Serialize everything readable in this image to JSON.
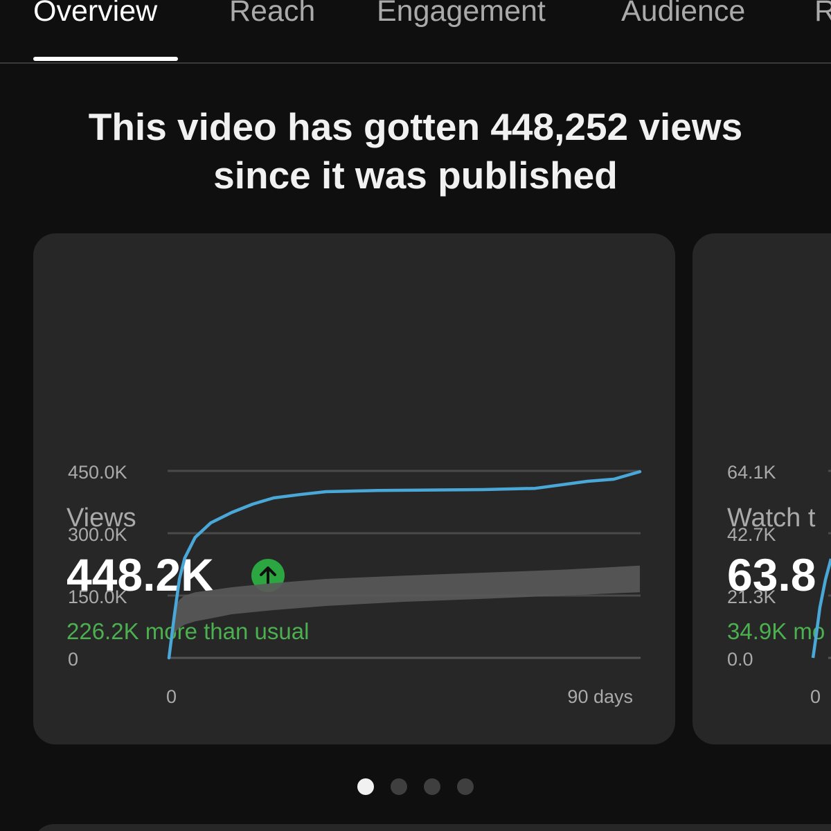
{
  "tabs": [
    {
      "label": "Overview",
      "active": true
    },
    {
      "label": "Reach",
      "active": false
    },
    {
      "label": "Engagement",
      "active": false
    },
    {
      "label": "Audience",
      "active": false
    },
    {
      "label": "R",
      "active": false
    }
  ],
  "headline": {
    "line1": "This video has gotten 448,252 views",
    "line2": "since it was published"
  },
  "cards": [
    {
      "label": "Views",
      "value": "448.2K",
      "trend_icon": "arrow-up-icon",
      "comparison": "226.2K more than usual"
    },
    {
      "label": "Watch t",
      "value": "63.8",
      "comparison": "34.9K mo"
    }
  ],
  "colors": {
    "background": "#0f0f0f",
    "card": "#272727",
    "series_line": "#4aa8d8",
    "typical_range": "#5a5a5a",
    "positive": "#4caf50",
    "badge": "#2ba640"
  },
  "chart_data": [
    {
      "type": "area",
      "x_tick_labels": [
        "0",
        "90 days"
      ],
      "y_tick_labels": [
        "0",
        "150.0K",
        "300.0K",
        "450.0K"
      ],
      "xlim": [
        0,
        90
      ],
      "ylim": [
        0,
        450000
      ],
      "series": [
        {
          "x": [
            0,
            1,
            2,
            3,
            5,
            8,
            12,
            16,
            20,
            25,
            30,
            40,
            50,
            60,
            70,
            80,
            85,
            90
          ],
          "values": [
            0,
            100000,
            190000,
            240000,
            290000,
            325000,
            350000,
            370000,
            385000,
            393000,
            400000,
            403000,
            404000,
            405000,
            408000,
            425000,
            430000,
            448200
          ]
        },
        {
          "type": "range",
          "x": [
            0,
            1,
            2,
            3,
            5,
            8,
            12,
            20,
            30,
            45,
            60,
            75,
            90
          ],
          "upper": [
            0,
            120000,
            140000,
            150000,
            158000,
            163000,
            170000,
            180000,
            190000,
            198000,
            205000,
            212000,
            222000
          ],
          "lower": [
            0,
            60000,
            72000,
            80000,
            88000,
            95000,
            105000,
            115000,
            125000,
            135000,
            142000,
            150000,
            158000
          ]
        }
      ]
    },
    {
      "type": "area",
      "x_tick_labels": [
        "0"
      ],
      "y_tick_labels": [
        "0.0",
        "21.3K",
        "42.7K",
        "64.1K"
      ],
      "xlim": [
        0,
        90
      ],
      "ylim": [
        0,
        64100
      ]
    }
  ],
  "pagination": {
    "count": 4,
    "active": 0
  }
}
